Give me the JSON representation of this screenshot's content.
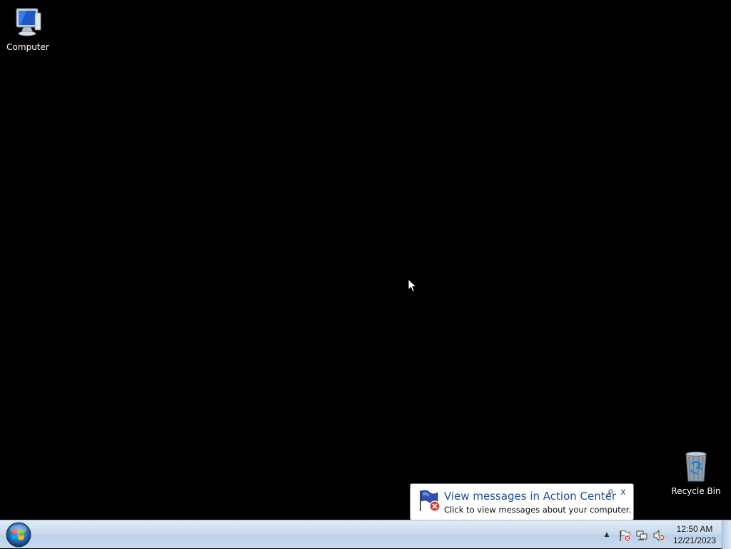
{
  "desktop": {
    "icons": [
      {
        "label": "Computer",
        "icon": "computer-icon"
      },
      {
        "label": "Recycle Bin",
        "icon": "recycle-bin-icon"
      }
    ]
  },
  "notification": {
    "title": "View messages in Action Center",
    "message": "Click to view messages about your computer.",
    "close_glyph": "x",
    "icon": "action-center-flag-error-icon"
  },
  "taskbar": {
    "start_icon": "windows-start-orb-icon",
    "tray": {
      "overflow_glyph": "▲",
      "icons": [
        "action-center-icon",
        "network-icon",
        "volume-muted-icon"
      ]
    },
    "clock": {
      "time": "12:50 AM",
      "date": "12/21/2023"
    }
  },
  "colors": {
    "desktop_background": "#000000",
    "balloon_title": "#1e4e9a",
    "taskbar": "#cbdcef"
  }
}
